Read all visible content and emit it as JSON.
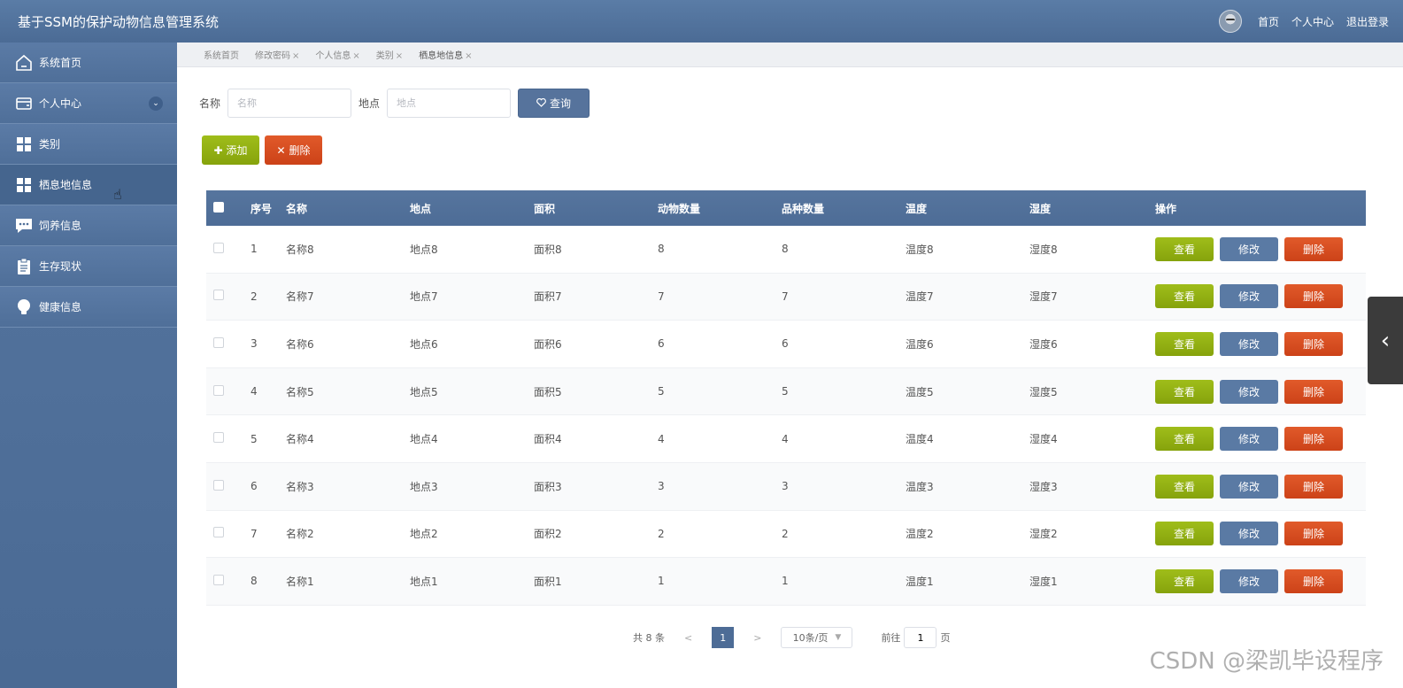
{
  "app": {
    "title": "基于SSM的保护动物信息管理系统"
  },
  "top_nav": {
    "home": "首页",
    "profile": "个人中心",
    "logout": "退出登录"
  },
  "sidebar": {
    "items": [
      {
        "label": "系统首页"
      },
      {
        "label": "个人中心"
      },
      {
        "label": "类别"
      },
      {
        "label": "栖息地信息"
      },
      {
        "label": "饲养信息"
      },
      {
        "label": "生存现状"
      },
      {
        "label": "健康信息"
      }
    ]
  },
  "tabs": [
    {
      "label": "系统首页"
    },
    {
      "label": "修改密码"
    },
    {
      "label": "个人信息"
    },
    {
      "label": "类别"
    },
    {
      "label": "栖息地信息"
    }
  ],
  "search": {
    "name_label": "名称",
    "name_placeholder": "名称",
    "location_label": "地点",
    "location_placeholder": "地点",
    "query_label": "查询"
  },
  "actions": {
    "add_label": "添加",
    "delete_label": "删除"
  },
  "table": {
    "headers": {
      "index": "序号",
      "name": "名称",
      "location": "地点",
      "area": "面积",
      "animal_count": "动物数量",
      "species_count": "品种数量",
      "temperature": "温度",
      "humidity": "湿度",
      "operations": "操作"
    },
    "op_labels": {
      "view": "查看",
      "edit": "修改",
      "delete": "删除"
    },
    "rows": [
      {
        "index": "1",
        "name": "名称8",
        "location": "地点8",
        "area": "面积8",
        "animal_count": "8",
        "species_count": "8",
        "temperature": "温度8",
        "humidity": "湿度8"
      },
      {
        "index": "2",
        "name": "名称7",
        "location": "地点7",
        "area": "面积7",
        "animal_count": "7",
        "species_count": "7",
        "temperature": "温度7",
        "humidity": "湿度7"
      },
      {
        "index": "3",
        "name": "名称6",
        "location": "地点6",
        "area": "面积6",
        "animal_count": "6",
        "species_count": "6",
        "temperature": "温度6",
        "humidity": "湿度6"
      },
      {
        "index": "4",
        "name": "名称5",
        "location": "地点5",
        "area": "面积5",
        "animal_count": "5",
        "species_count": "5",
        "temperature": "温度5",
        "humidity": "湿度5"
      },
      {
        "index": "5",
        "name": "名称4",
        "location": "地点4",
        "area": "面积4",
        "animal_count": "4",
        "species_count": "4",
        "temperature": "温度4",
        "humidity": "湿度4"
      },
      {
        "index": "6",
        "name": "名称3",
        "location": "地点3",
        "area": "面积3",
        "animal_count": "3",
        "species_count": "3",
        "temperature": "温度3",
        "humidity": "湿度3"
      },
      {
        "index": "7",
        "name": "名称2",
        "location": "地点2",
        "area": "面积2",
        "animal_count": "2",
        "species_count": "2",
        "temperature": "温度2",
        "humidity": "湿度2"
      },
      {
        "index": "8",
        "name": "名称1",
        "location": "地点1",
        "area": "面积1",
        "animal_count": "1",
        "species_count": "1",
        "temperature": "温度1",
        "humidity": "湿度1"
      }
    ]
  },
  "pagination": {
    "total": "共 8 条",
    "prev": "<",
    "current_page": "1",
    "next": ">",
    "page_size": "10条/页",
    "goto_label": "前往",
    "goto_value": "1",
    "page_suffix": "页"
  },
  "watermark": "CSDN @梁凯毕设程序",
  "colors": {
    "header": "#4d6c96",
    "green": "#8fad12",
    "red": "#d74c1f"
  }
}
